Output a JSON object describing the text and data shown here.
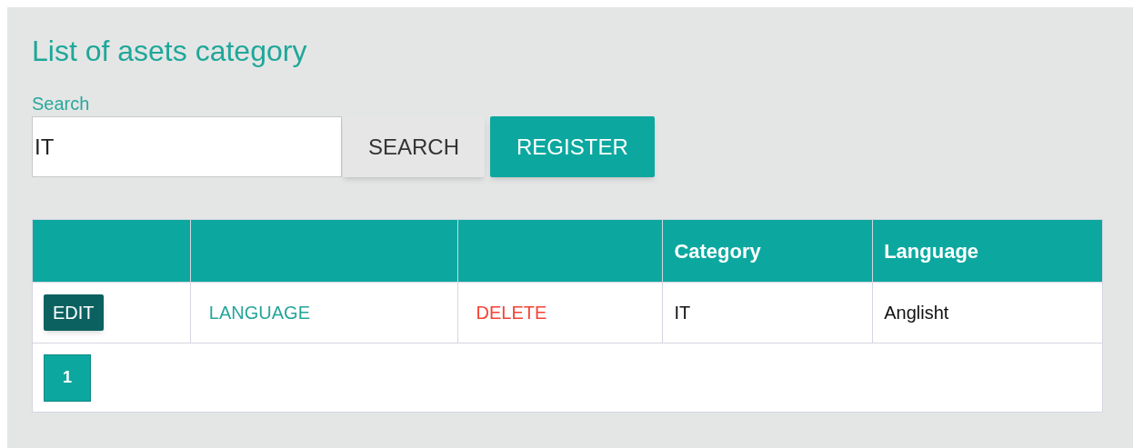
{
  "title": "List of asets category",
  "search": {
    "label": "Search",
    "value": "IT"
  },
  "buttons": [
    {
      "kind": "plain",
      "label": "SEARCH"
    },
    {
      "kind": "primary",
      "label": "REGISTER"
    }
  ],
  "table": {
    "columns": [
      "",
      "",
      "",
      "Category",
      "Language"
    ],
    "rows": [
      {
        "edit": "EDIT",
        "language_link": "LANGUAGE",
        "delete_link": "DELETE",
        "category": "IT",
        "language": "Anglisht"
      }
    ]
  },
  "pagination": [
    {
      "label": "1",
      "selected": true
    }
  ]
}
